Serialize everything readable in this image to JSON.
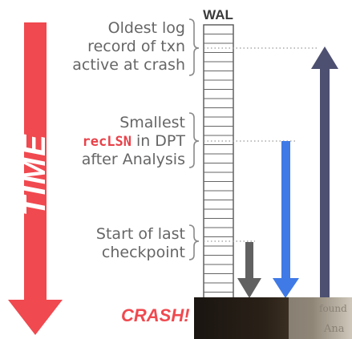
{
  "time_label": "TIME",
  "wal_label": "WAL",
  "crash_label": "CRASH!",
  "annotations": [
    {
      "id": "oldest-log",
      "lines": [
        "Oldest log",
        "record of txn",
        "active at crash"
      ]
    },
    {
      "id": "smallest-reclsn",
      "lines": [
        "Smallest",
        "in DPT",
        "after Analysis"
      ],
      "highlight": "recLSN"
    },
    {
      "id": "checkpoint",
      "lines": [
        "Start of last",
        "checkpoint"
      ]
    }
  ],
  "colors": {
    "time_arrow": "#f0494f",
    "crash_text": "#f0494f",
    "reclsn_text": "#e8424a",
    "arrow_checkpoint": "#616161",
    "arrow_reclsn": "#3f7ae6",
    "arrow_oldest": "#4d5070",
    "label_text": "#666666"
  },
  "photo_text": [
    "found",
    "Ana"
  ]
}
